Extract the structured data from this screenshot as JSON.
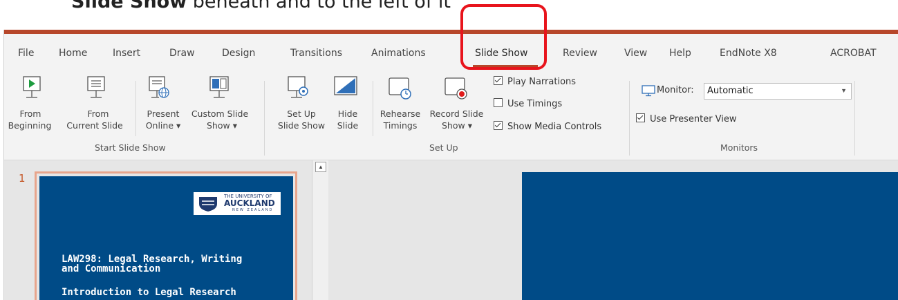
{
  "caption": {
    "bold": "Slide Show",
    "rest": " beneath and to the left of it"
  },
  "tabs": [
    {
      "label": "File"
    },
    {
      "label": "Home"
    },
    {
      "label": "Insert"
    },
    {
      "label": "Draw"
    },
    {
      "label": "Design"
    },
    {
      "label": "Transitions"
    },
    {
      "label": "Animations"
    },
    {
      "label": "Slide Show",
      "active": true
    },
    {
      "label": "Review"
    },
    {
      "label": "View"
    },
    {
      "label": "Help"
    },
    {
      "label": "EndNote X8"
    },
    {
      "label": "ACROBAT"
    }
  ],
  "ribbon": {
    "start_slide_show": {
      "label": "Start Slide Show",
      "buttons": {
        "from_beginning": [
          "From",
          "Beginning"
        ],
        "from_current": [
          "From",
          "Current Slide"
        ],
        "present_online": [
          "Present",
          "Online ▾"
        ],
        "custom_show": [
          "Custom Slide",
          "Show ▾"
        ]
      }
    },
    "setup": {
      "label": "Set Up",
      "buttons": {
        "setup_show": [
          "Set Up",
          "Slide Show"
        ],
        "hide_slide": [
          "Hide",
          "Slide"
        ],
        "rehearse": [
          "Rehearse",
          "Timings"
        ],
        "record": [
          "Record Slide",
          "Show ▾"
        ]
      },
      "checks": {
        "play_narrations": "Play Narrations",
        "use_timings": "Use Timings",
        "show_media_controls": "Show Media Controls"
      }
    },
    "monitors": {
      "label": "Monitors",
      "monitor_label": "Monitor:",
      "monitor_value": "Automatic",
      "presenter_view": "Use Presenter View"
    }
  },
  "thumbnail": {
    "number": "1",
    "title_line1": "LAW298: Legal Research, Writing",
    "title_line2": "and Communication",
    "subtitle": "Introduction to Legal Research",
    "logo_line1": "THE UNIVERSITY OF",
    "logo_line2": "AUCKLAND",
    "logo_line3": "NEW ZEALAND"
  },
  "colors": {
    "accent": "#b7472a",
    "highlight": "#e8141c",
    "slide_blue": "#004b87"
  }
}
